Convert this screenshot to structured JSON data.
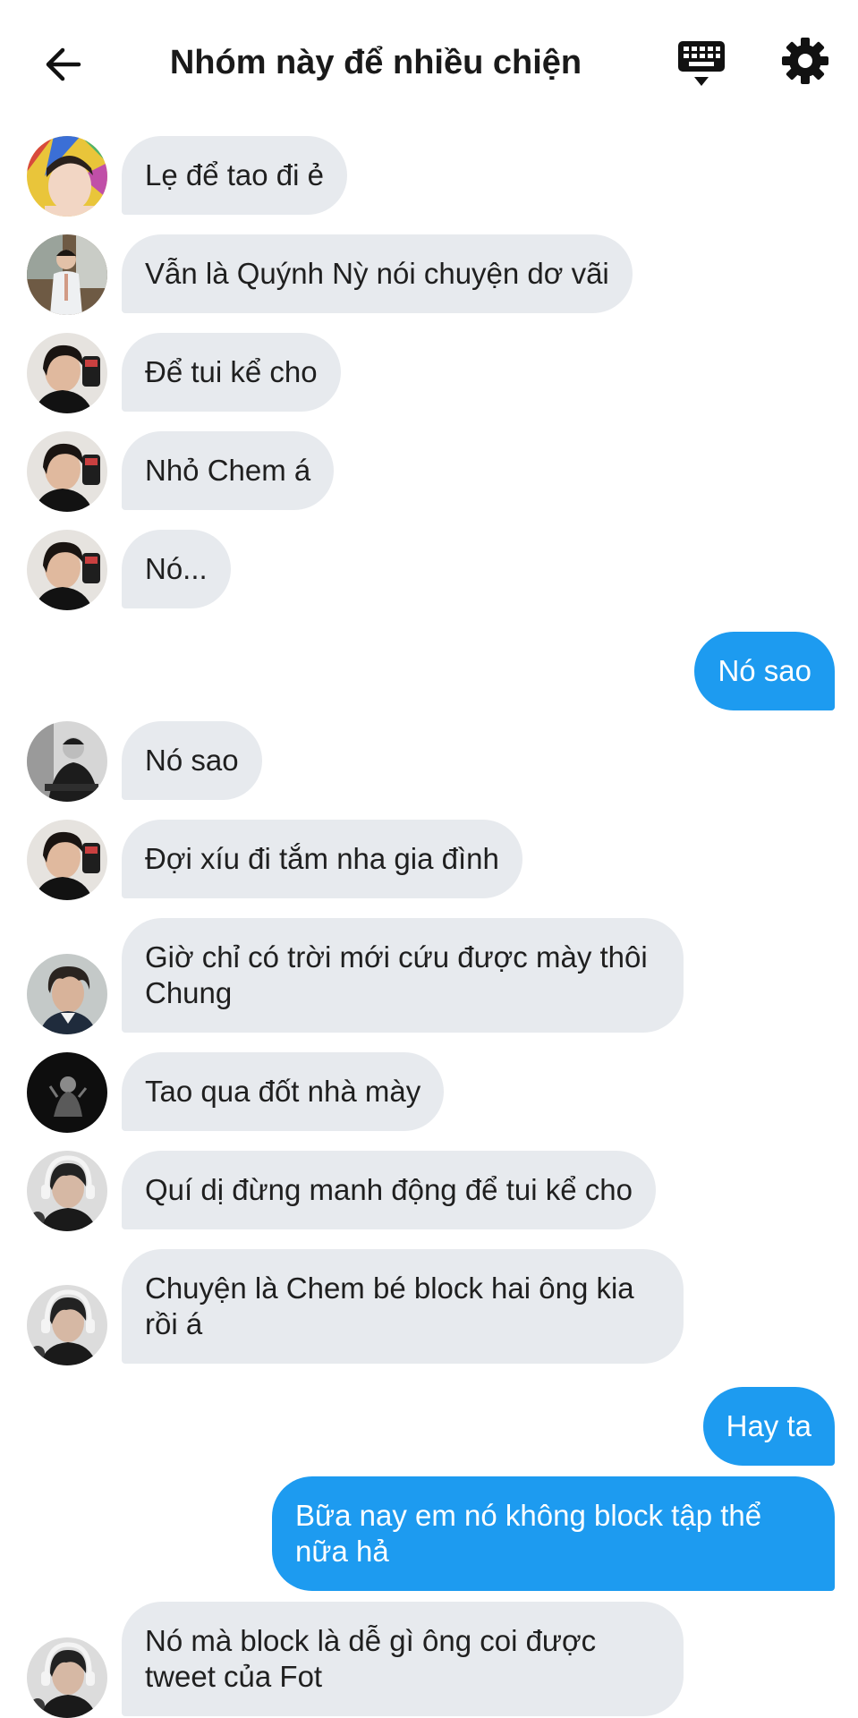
{
  "header": {
    "title": "Nhóm này để nhiều chiện",
    "back_icon": "arrow-left-icon",
    "keyboard_icon": "keyboard-icon",
    "settings_icon": "gear-icon"
  },
  "messages": [
    {
      "direction": "in",
      "text": "Lẹ để tao đi ẻ",
      "avatar": "avatar-colorful"
    },
    {
      "direction": "in",
      "text": "Vẫn là Quýnh Nỳ nói chuyện dơ vãi",
      "avatar": "avatar-standing"
    },
    {
      "direction": "in",
      "text": "Để tui kể cho",
      "avatar": "avatar-selfie"
    },
    {
      "direction": "in",
      "text": "Nhỏ Chem á",
      "avatar": "avatar-selfie"
    },
    {
      "direction": "in",
      "text": "Nó...",
      "avatar": "avatar-selfie"
    },
    {
      "direction": "out",
      "text": "Nó sao"
    },
    {
      "direction": "in",
      "text": "Nó sao",
      "avatar": "avatar-bw"
    },
    {
      "direction": "in",
      "text": "Đợi xíu đi tắm nha gia đình",
      "avatar": "avatar-selfie"
    },
    {
      "direction": "in",
      "text": "Giờ chỉ có trời mới cứu được mày thôi Chung",
      "avatar": "avatar-curly"
    },
    {
      "direction": "in",
      "text": "Tao qua đốt nhà mày",
      "avatar": "avatar-dark"
    },
    {
      "direction": "in",
      "text": "Quí dị đừng manh động để tui kể cho",
      "avatar": "avatar-headphones"
    },
    {
      "direction": "in",
      "text": "Chuyện là Chem bé block hai ông kia rồi á",
      "avatar": "avatar-headphones"
    },
    {
      "direction": "out",
      "text": "Hay ta"
    },
    {
      "direction": "out",
      "text": "Bữa nay em nó không block tập thể nữa hả"
    },
    {
      "direction": "in",
      "text": "Nó mà block là dễ gì ông coi được tweet của Fot",
      "avatar": "avatar-headphones"
    }
  ],
  "colors": {
    "incoming_bubble": "#e7eaee",
    "outgoing_bubble": "#1d9bf0",
    "text_dark": "#1f1f1f",
    "text_light": "#ffffff"
  }
}
